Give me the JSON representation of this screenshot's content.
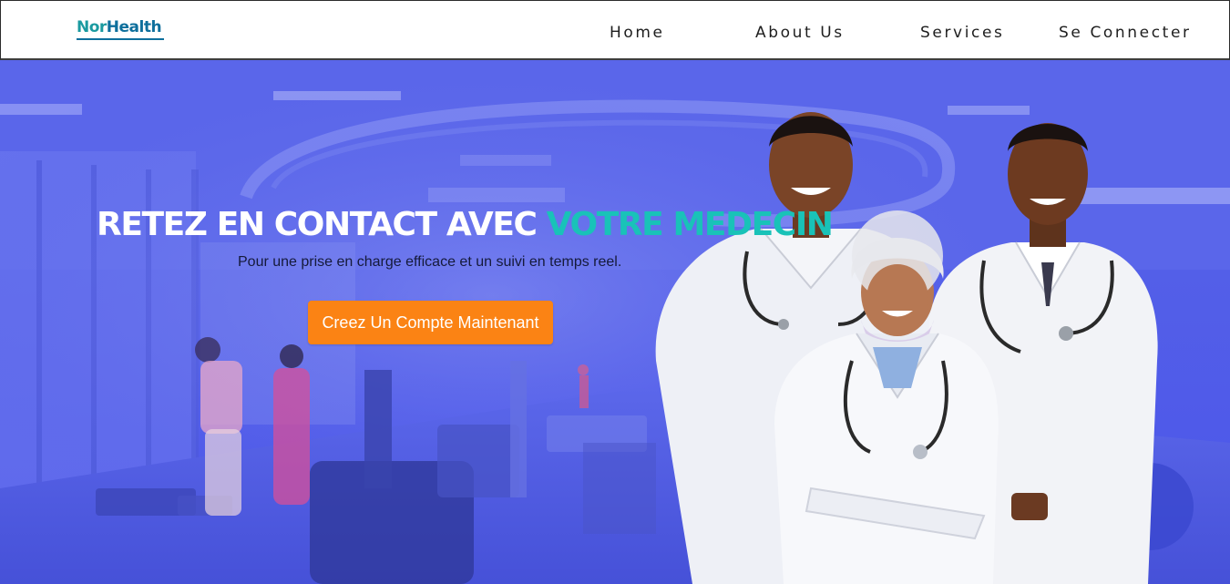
{
  "brand": {
    "logo_part1": "Nor",
    "logo_part2": "Health",
    "color_primary": "#1a9aa0",
    "color_secondary": "#0e6f9c"
  },
  "nav": {
    "items": [
      {
        "label": "Home"
      },
      {
        "label": "About Us"
      },
      {
        "label": "Services"
      },
      {
        "label": "Se Connecter"
      }
    ]
  },
  "hero": {
    "headline_main": "RETEZ EN CONTACT AVEC ",
    "headline_accent": "VOTRE MEDECIN",
    "subtitle": "Pour une prise en charge efficace et un suivi en temps reel.",
    "cta_label": "Creez Un Compte Maintenant",
    "overlay_color": "#5460e8",
    "accent_color": "#19c2b8",
    "cta_color": "#fb8314"
  }
}
